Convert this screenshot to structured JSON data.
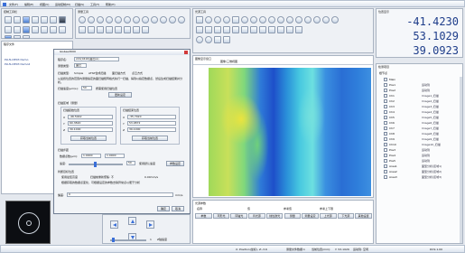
{
  "menu": {
    "items": [
      "文件(F)",
      "编辑(E)",
      "视图(V)",
      "运动控制(M)",
      "扫描(S)",
      "工具(T)",
      "帮助(H)"
    ]
  },
  "top_tabs": {
    "left": "控制工具栏",
    "center": "测量工具",
    "right": "光源工具"
  },
  "right_panel": {
    "title": "位置显示",
    "coords": {
      "x": "-41.4230",
      "y": "53.1029",
      "z": "39.0923"
    },
    "tree_title": "检测项目",
    "tree_root": "根节点",
    "tree_items": [
      {
        "name": "Main",
        "value": ""
      },
      {
        "name": "Pos1",
        "value": "运动到"
      },
      {
        "name": "Pos2",
        "value": "运动到"
      },
      {
        "name": "Ch1",
        "value": "Image1_扫描"
      },
      {
        "name": "Ch2",
        "value": "Image2_扫描"
      },
      {
        "name": "Ch3",
        "value": "Image3_扫描"
      },
      {
        "name": "Ch4",
        "value": "Image4_扫描"
      },
      {
        "name": "Ch5",
        "value": "Image5_扫描"
      },
      {
        "name": "Ch6",
        "value": "Image6_扫描"
      },
      {
        "name": "Ch7",
        "value": "Image7_扫描"
      },
      {
        "name": "Ch8",
        "value": "Image8_扫描"
      },
      {
        "name": "Ch9",
        "value": "Image9_扫描"
      },
      {
        "name": "Ch10",
        "value": "Image10_扫描"
      },
      {
        "name": "Pos3",
        "value": "运动到"
      },
      {
        "name": "Pos4",
        "value": "运动到"
      },
      {
        "name": "Pos5",
        "value": "运动到"
      },
      {
        "name": "Area1",
        "value": "面型分析(区域1)"
      },
      {
        "name": "Area2",
        "value": "面型分析(区域2)"
      },
      {
        "name": "Area3",
        "value": "面型分析(区域3)"
      }
    ]
  },
  "left_panel": {
    "title": "程序文件",
    "files": [
      "PLUS-DE03 Demo",
      "PLUS-DE03 Demo2"
    ]
  },
  "dialog": {
    "title": "Gisbee3000",
    "name_label": "程序名:",
    "name_value": "z21(0416)面扫(a)",
    "type_label": "测量类型:",
    "type_value": "面扫",
    "mode_label": "扫描类型:",
    "mode_options": [
      "Simple",
      "ATSP合成扫描",
      "面扫描方式",
      "点云方式"
    ],
    "desc": "从最终位置的范围内测量指定的面扫描矩阵格式执行一扫描，得到以指定数据点，然后生成扫描结果并分析。",
    "speed_label": "扫描速度(μm/s):",
    "speed_value": "50",
    "speed_check": "按需使用扫描位置",
    "apply_btn": "更新设定",
    "area_title": "扫描区域（测量）",
    "start_title": "扫描起始位置",
    "end_title": "扫描结束位置",
    "start": {
      "x": "-46.5042",
      "y": "60.3820",
      "z": "39.1000"
    },
    "end": {
      "x": "-35.7020",
      "y": "53.0872",
      "z": "39.1000"
    },
    "start_btn": "获取当前位置",
    "end_btn": "获取当前位置",
    "step_title": "扫描步距",
    "step_label": "数据点数(μm):",
    "step_x": "1.0000",
    "step_y": "1.0000",
    "rate_label": "速度:",
    "rate_value": "50",
    "rate_check": "使用默认速度",
    "rate_btn": "参数设定",
    "judge_title": "判断目标位置",
    "judge_opt1": "使用最佳高度",
    "judge_opt2": "扫描前重新聚焦: 不",
    "judge_unit": "0.00mm/s",
    "judge_desc": "根据获取的数据点变化，可根据设定的参数去除异常点以便于分析",
    "tol_label": "偏差:",
    "tol_value": "0",
    "tol_unit": "mm/s",
    "ok_btn": "确定",
    "cancel_btn": "取消"
  },
  "image_view": {
    "title": "图像显示窗口",
    "tab": "图像/三维视图"
  },
  "bottom_panel": {
    "title": "光源参数",
    "headers": [
      "名称",
      "值",
      "参考值",
      "参考上下限"
    ],
    "buttons": [
      "参数",
      "环形光",
      "同轴光",
      "背光源",
      "线性激光",
      "测量",
      "测量设定",
      "上光源",
      "下光源",
      "其他设置"
    ]
  },
  "slider": {
    "value": "1",
    "label": "Z轴速度"
  },
  "status_bar": {
    "items": [
      "X: Position(坐标), Z:-3.6",
      "测量文件数据:1",
      "当前位置(mm):",
      "Y: 53.1029",
      "运动到: 空闲",
      "DCS:1.00"
    ]
  },
  "colors": {
    "accent": "#3a6fd8",
    "panel": "#eef1f5",
    "title_blue": "#1e3d8a"
  }
}
